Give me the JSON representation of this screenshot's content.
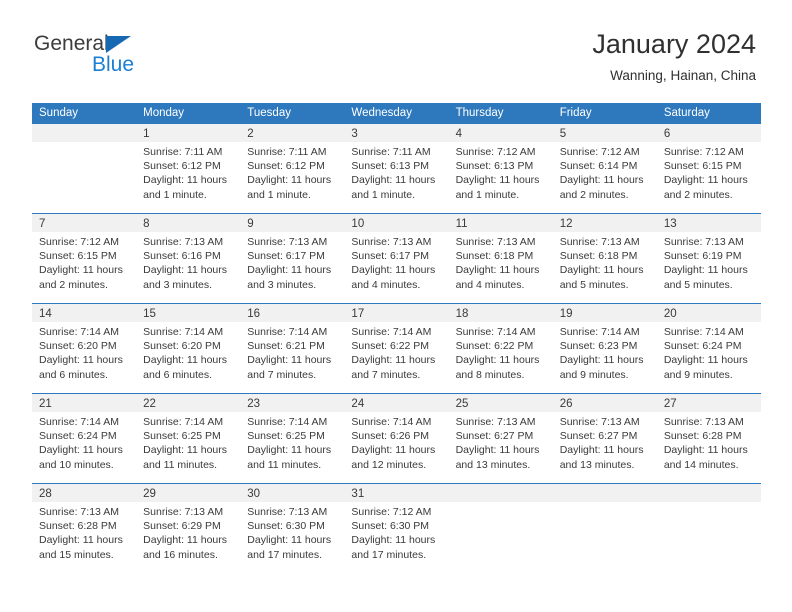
{
  "brand": {
    "name_top": "General",
    "name_bottom": "Blue",
    "accent_color": "#1668b3",
    "blue_text_color": "#1b7fd4"
  },
  "header": {
    "title": "January 2024",
    "subtitle": "Wanning, Hainan, China"
  },
  "calendar": {
    "header_bg": "#2e79bd",
    "day_band_bg": "#f1f1f1",
    "weekdays": [
      "Sunday",
      "Monday",
      "Tuesday",
      "Wednesday",
      "Thursday",
      "Friday",
      "Saturday"
    ],
    "weeks": [
      [
        {
          "day": "",
          "lines": []
        },
        {
          "day": "1",
          "lines": [
            "Sunrise: 7:11 AM",
            "Sunset: 6:12 PM",
            "Daylight: 11 hours and 1 minute."
          ]
        },
        {
          "day": "2",
          "lines": [
            "Sunrise: 7:11 AM",
            "Sunset: 6:12 PM",
            "Daylight: 11 hours and 1 minute."
          ]
        },
        {
          "day": "3",
          "lines": [
            "Sunrise: 7:11 AM",
            "Sunset: 6:13 PM",
            "Daylight: 11 hours and 1 minute."
          ]
        },
        {
          "day": "4",
          "lines": [
            "Sunrise: 7:12 AM",
            "Sunset: 6:13 PM",
            "Daylight: 11 hours and 1 minute."
          ]
        },
        {
          "day": "5",
          "lines": [
            "Sunrise: 7:12 AM",
            "Sunset: 6:14 PM",
            "Daylight: 11 hours and 2 minutes."
          ]
        },
        {
          "day": "6",
          "lines": [
            "Sunrise: 7:12 AM",
            "Sunset: 6:15 PM",
            "Daylight: 11 hours and 2 minutes."
          ]
        }
      ],
      [
        {
          "day": "7",
          "lines": [
            "Sunrise: 7:12 AM",
            "Sunset: 6:15 PM",
            "Daylight: 11 hours and 2 minutes."
          ]
        },
        {
          "day": "8",
          "lines": [
            "Sunrise: 7:13 AM",
            "Sunset: 6:16 PM",
            "Daylight: 11 hours and 3 minutes."
          ]
        },
        {
          "day": "9",
          "lines": [
            "Sunrise: 7:13 AM",
            "Sunset: 6:17 PM",
            "Daylight: 11 hours and 3 minutes."
          ]
        },
        {
          "day": "10",
          "lines": [
            "Sunrise: 7:13 AM",
            "Sunset: 6:17 PM",
            "Daylight: 11 hours and 4 minutes."
          ]
        },
        {
          "day": "11",
          "lines": [
            "Sunrise: 7:13 AM",
            "Sunset: 6:18 PM",
            "Daylight: 11 hours and 4 minutes."
          ]
        },
        {
          "day": "12",
          "lines": [
            "Sunrise: 7:13 AM",
            "Sunset: 6:18 PM",
            "Daylight: 11 hours and 5 minutes."
          ]
        },
        {
          "day": "13",
          "lines": [
            "Sunrise: 7:13 AM",
            "Sunset: 6:19 PM",
            "Daylight: 11 hours and 5 minutes."
          ]
        }
      ],
      [
        {
          "day": "14",
          "lines": [
            "Sunrise: 7:14 AM",
            "Sunset: 6:20 PM",
            "Daylight: 11 hours and 6 minutes."
          ]
        },
        {
          "day": "15",
          "lines": [
            "Sunrise: 7:14 AM",
            "Sunset: 6:20 PM",
            "Daylight: 11 hours and 6 minutes."
          ]
        },
        {
          "day": "16",
          "lines": [
            "Sunrise: 7:14 AM",
            "Sunset: 6:21 PM",
            "Daylight: 11 hours and 7 minutes."
          ]
        },
        {
          "day": "17",
          "lines": [
            "Sunrise: 7:14 AM",
            "Sunset: 6:22 PM",
            "Daylight: 11 hours and 7 minutes."
          ]
        },
        {
          "day": "18",
          "lines": [
            "Sunrise: 7:14 AM",
            "Sunset: 6:22 PM",
            "Daylight: 11 hours and 8 minutes."
          ]
        },
        {
          "day": "19",
          "lines": [
            "Sunrise: 7:14 AM",
            "Sunset: 6:23 PM",
            "Daylight: 11 hours and 9 minutes."
          ]
        },
        {
          "day": "20",
          "lines": [
            "Sunrise: 7:14 AM",
            "Sunset: 6:24 PM",
            "Daylight: 11 hours and 9 minutes."
          ]
        }
      ],
      [
        {
          "day": "21",
          "lines": [
            "Sunrise: 7:14 AM",
            "Sunset: 6:24 PM",
            "Daylight: 11 hours and 10 minutes."
          ]
        },
        {
          "day": "22",
          "lines": [
            "Sunrise: 7:14 AM",
            "Sunset: 6:25 PM",
            "Daylight: 11 hours and 11 minutes."
          ]
        },
        {
          "day": "23",
          "lines": [
            "Sunrise: 7:14 AM",
            "Sunset: 6:25 PM",
            "Daylight: 11 hours and 11 minutes."
          ]
        },
        {
          "day": "24",
          "lines": [
            "Sunrise: 7:14 AM",
            "Sunset: 6:26 PM",
            "Daylight: 11 hours and 12 minutes."
          ]
        },
        {
          "day": "25",
          "lines": [
            "Sunrise: 7:13 AM",
            "Sunset: 6:27 PM",
            "Daylight: 11 hours and 13 minutes."
          ]
        },
        {
          "day": "26",
          "lines": [
            "Sunrise: 7:13 AM",
            "Sunset: 6:27 PM",
            "Daylight: 11 hours and 13 minutes."
          ]
        },
        {
          "day": "27",
          "lines": [
            "Sunrise: 7:13 AM",
            "Sunset: 6:28 PM",
            "Daylight: 11 hours and 14 minutes."
          ]
        }
      ],
      [
        {
          "day": "28",
          "lines": [
            "Sunrise: 7:13 AM",
            "Sunset: 6:28 PM",
            "Daylight: 11 hours and 15 minutes."
          ]
        },
        {
          "day": "29",
          "lines": [
            "Sunrise: 7:13 AM",
            "Sunset: 6:29 PM",
            "Daylight: 11 hours and 16 minutes."
          ]
        },
        {
          "day": "30",
          "lines": [
            "Sunrise: 7:13 AM",
            "Sunset: 6:30 PM",
            "Daylight: 11 hours and 17 minutes."
          ]
        },
        {
          "day": "31",
          "lines": [
            "Sunrise: 7:12 AM",
            "Sunset: 6:30 PM",
            "Daylight: 11 hours and 17 minutes."
          ]
        },
        {
          "day": "",
          "lines": []
        },
        {
          "day": "",
          "lines": []
        },
        {
          "day": "",
          "lines": []
        }
      ]
    ]
  }
}
